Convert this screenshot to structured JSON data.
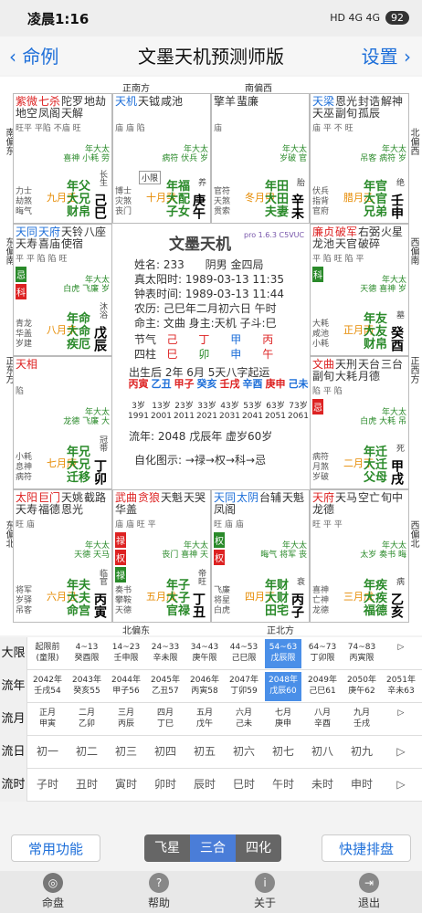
{
  "status": {
    "time": "凌晨1:16",
    "battery": "92",
    "signal": "HD 4G 4G"
  },
  "nav": {
    "back": "命例",
    "title": "文墨天机预测师版",
    "settings": "设置"
  },
  "dirs": {
    "top1": "正南方",
    "top2": "南偏西",
    "bottom1": "北偏东",
    "bottom2": "正北方",
    "left1": "南偏东",
    "left2": "东偏南",
    "left3": "正东方",
    "left4": "东偏北",
    "right1": "西偏南",
    "right2": "正西方",
    "right3": "西偏北",
    "right4": "北偏西"
  },
  "cells": [
    {
      "id": "si",
      "stars": [
        [
          "紫微",
          "#d22"
        ],
        [
          "七杀",
          "#d22"
        ],
        [
          "陀罗",
          "#333"
        ],
        [
          "地劫",
          "#333"
        ],
        [
          "地空",
          "#333"
        ],
        [
          "凤阁",
          "#333"
        ],
        [
          "天解",
          "#333"
        ]
      ],
      "bright": "旺平 平陷 不庙 旺",
      "minor": "年大太\n喜神 小耗 劳",
      "gods": "力士\n劫煞\n晦气",
      "age": "九月壬",
      "pal": "年父\n大兄\n财帛",
      "palcolor": "#2a8a2a",
      "chs": "长生",
      "gz": "己巳",
      "small": ""
    },
    {
      "id": "wu",
      "stars": [
        [
          "天机",
          "#1e6fd9"
        ],
        [
          "天钺",
          "#333"
        ],
        [
          "咸池",
          "#333"
        ]
      ],
      "bright": "庙 庙 陷",
      "minor": "年大太\n病符 伏兵 岁",
      "gods": "博士\n灾煞\n丧门",
      "age": "十月癸",
      "pal": "年福\n大配\n子女",
      "palcolor": "#2a8a2a",
      "chs": "养",
      "gz": "庚午",
      "small": "小限"
    },
    {
      "id": "wei",
      "stars": [
        [
          "擎羊",
          "#333"
        ],
        [
          "蜚廉",
          "#333"
        ]
      ],
      "bright": "庙",
      "minor": "年大太\n岁破 官",
      "gods": "官符\n天煞\n贯索",
      "age": "冬月甲",
      "pal": "年田\n大田\n夫妻",
      "palcolor": "#2a8a2a",
      "chs": "胎",
      "gz": "辛未",
      "small": ""
    },
    {
      "id": "shen",
      "stars": [
        [
          "天梁",
          "#1e6fd9"
        ],
        [
          "恩光",
          "#333"
        ],
        [
          "封诰",
          "#333"
        ],
        [
          "解神",
          "#333"
        ],
        [
          "天巫",
          "#333"
        ],
        [
          "副旬",
          "#333"
        ],
        [
          "孤辰",
          "#333"
        ]
      ],
      "bright": "庙 平 不 旺",
      "minor": "年大太\n吊客 病符 岁",
      "gods": "伏兵\n指背\n官府",
      "age": "腊月乙",
      "pal": "年官\n大官\n兄弟",
      "palcolor": "#2a8a2a",
      "chs": "绝",
      "gz": "壬申",
      "small": ""
    },
    {
      "id": "chen",
      "stars": [
        [
          "天同",
          "#1e6fd9"
        ],
        [
          "天府",
          "#1e6fd9"
        ],
        [
          "天铃",
          "#333"
        ],
        [
          "八座",
          "#333"
        ],
        [
          "天寿",
          "#333"
        ],
        [
          "喜庙",
          "#333"
        ],
        [
          "使宿",
          "#333"
        ]
      ],
      "bright": "平 平 陷 陷 旺",
      "minor": "年大太\n白虎 飞廉 岁",
      "gods": "青龙\n华盖\n岁建",
      "age": "八月辛",
      "pal": "年命\n大命\n疾厄",
      "palcolor": "#2a8a2a",
      "chs": "沐浴",
      "gz": "戊辰",
      "small": "",
      "hua": [
        [
          "忌",
          "#2a8a2a"
        ],
        [
          "科",
          "#d22"
        ]
      ]
    },
    {
      "id": "you",
      "stars": [
        [
          "廉贞",
          "#d22"
        ],
        [
          "破军",
          "#d22"
        ],
        [
          "右弼",
          "#333"
        ],
        [
          "火星",
          "#333"
        ],
        [
          "龙池",
          "#333"
        ],
        [
          "天官",
          "#333"
        ],
        [
          "破碎",
          "#333"
        ]
      ],
      "bright": "平 陷 旺 陷 平",
      "minor": "年大太\n天德 喜神 岁",
      "gods": "大耗\n咸池\n小耗",
      "age": "正月丙",
      "pal": "年友\n大友\n财帛",
      "palcolor": "#2a8a2a",
      "chs": "墓",
      "gz": "癸酉",
      "small": "",
      "hua": [
        [
          "科",
          "#2a8a2a"
        ]
      ]
    },
    {
      "id": "mao",
      "stars": [
        [
          "天相",
          "#d22"
        ]
      ],
      "bright": "陷",
      "minor": "年大太\n龙德 飞廉 大",
      "gods": "小耗\n息神\n病符",
      "age": "七月庚",
      "pal": "年兄\n大兄\n迁移",
      "palcolor": "#2a8a2a",
      "chs": "冠带",
      "gz": "丁卯",
      "small": ""
    },
    {
      "id": "xu",
      "stars": [
        [
          "文曲",
          "#d22"
        ],
        [
          "天刑",
          "#333"
        ],
        [
          "天台",
          "#333"
        ],
        [
          "三台",
          "#333"
        ],
        [
          "副旬",
          "#333"
        ],
        [
          "大耗",
          "#333"
        ],
        [
          "月德",
          "#333"
        ]
      ],
      "bright": "陷 平 陷",
      "minor": "年大太\n白虎 大耗 吊",
      "gods": "病符\n月煞\n岁破",
      "age": "二月丁",
      "pal": "年迁\n大迁\n父母",
      "palcolor": "#2a8a2a",
      "chs": "死",
      "gz": "甲戌",
      "small": "",
      "hua": [
        [
          "忌",
          "#d22"
        ]
      ]
    },
    {
      "id": "yin",
      "stars": [
        [
          "太阳",
          "#d22"
        ],
        [
          "巨门",
          "#d22"
        ],
        [
          "天姚",
          "#333"
        ],
        [
          "截路",
          "#333"
        ],
        [
          "天寿",
          "#333"
        ],
        [
          "福德",
          "#333"
        ],
        [
          "恩光",
          "#333"
        ]
      ],
      "bright": "旺 庙",
      "minor": "年大太\n天德 天马",
      "gods": "将军\n岁驿\n吊客",
      "age": "六月己",
      "pal": "年夫\n大夫\n命宫",
      "palcolor": "#2a8a2a",
      "chs": "临官",
      "gz": "丙寅",
      "small": ""
    },
    {
      "id": "chou",
      "stars": [
        [
          "武曲",
          "#d22"
        ],
        [
          "贪狼",
          "#d22"
        ],
        [
          "天魁",
          "#333"
        ],
        [
          "天哭",
          "#333"
        ],
        [
          "华盖",
          "#333"
        ]
      ],
      "bright": "庙 庙 旺 平",
      "minor": "年大太\n丧门 喜神 天",
      "gods": "奏书\n攀鞍\n天德",
      "age": "五月戊",
      "pal": "年子\n大子\n官禄",
      "palcolor": "#2a8a2a",
      "chs": "帝旺",
      "gz": "丁丑",
      "small": "",
      "hua": [
        [
          "禄",
          "#d22"
        ],
        [
          "权",
          "#d22"
        ],
        [
          "禄",
          "#2a8a2a"
        ]
      ]
    },
    {
      "id": "zi",
      "stars": [
        [
          "天同",
          "#1e6fd9"
        ],
        [
          "太阴",
          "#1e6fd9"
        ],
        [
          "台辅",
          "#333"
        ],
        [
          "天魁",
          "#333"
        ],
        [
          "凤阁",
          "#333"
        ]
      ],
      "bright": "旺 庙 庙",
      "minor": "年大太\n晦气 将军 丧",
      "gods": "飞廉\n将星\n白虎",
      "age": "四月丁",
      "pal": "年财\n大财\n田宅",
      "palcolor": "#2a8a2a",
      "chs": "衰",
      "gz": "丙子",
      "small": "",
      "hua": [
        [
          "权",
          "#2a8a2a"
        ],
        [
          "权",
          "#d22"
        ]
      ]
    },
    {
      "id": "hai",
      "stars": [
        [
          "天府",
          "#d22"
        ],
        [
          "天马",
          "#333"
        ],
        [
          "空亡",
          "#333"
        ],
        [
          "旬中",
          "#333"
        ],
        [
          "龙德",
          "#333"
        ]
      ],
      "bright": "旺 平 平",
      "minor": "年大太\n太岁 奏书 晦",
      "gods": "喜神\n亡神\n龙德",
      "age": "三月戊",
      "pal": "年疾\n大疾\n福德",
      "palcolor": "#2a8a2a",
      "chs": "病",
      "gz": "乙亥",
      "small": ""
    }
  ],
  "center": {
    "title": "文墨天机",
    "ver": "pro 1.6.3 C5VUC",
    "name": "姓名: 233",
    "gender": "阴男 金四局",
    "sun_time": "真太阳时: 1989-03-13 11:35",
    "clock_time": "钟表时间: 1989-03-13 11:44",
    "lunar": "农历: 己巳年二月初六日 午时",
    "ming": "命主: 文曲 身主:天机 子斗:巳",
    "jieqi_label": "节气",
    "sizhu_label": "四柱",
    "pillars": [
      "己",
      "丁",
      "甲",
      "丙",
      "巳",
      "卯",
      "申",
      "午"
    ],
    "qiyun": "出生后 2年 6月 5天八字起运",
    "dayun_gz": [
      "丙寅",
      "乙丑",
      "甲子",
      "癸亥",
      "壬戌",
      "辛酉",
      "庚申",
      "己未"
    ],
    "dayun_age": [
      "3岁",
      "13岁",
      "23岁",
      "33岁",
      "43岁",
      "53岁",
      "63岁",
      "73岁"
    ],
    "dayun_year": [
      "1991",
      "2001",
      "2011",
      "2021",
      "2031",
      "2041",
      "2051",
      "2061"
    ],
    "liunian": "流年: 2048 戊辰年 虚岁60岁",
    "zihua": "自化图示: →禄→权→科→忌"
  },
  "timeline": {
    "rows": [
      "大限",
      "流年",
      "流月",
      "流日",
      "流时"
    ],
    "daxian": [
      "起限前\n(童限)",
      "4~13\n癸酉限",
      "14~23\n壬申限",
      "24~33\n辛未限",
      "34~43\n庚午限",
      "44~53\n己巳限",
      "54~63\n戊辰限",
      "64~73\n丁卯限",
      "74~83\n丙寅限",
      "▷"
    ],
    "liunian": [
      "2042年\n壬戌54",
      "2043年\n癸亥55",
      "2044年\n甲子56",
      "2045年\n乙丑57",
      "2046年\n丙寅58",
      "2047年\n丁卯59",
      "2048年\n戊辰60",
      "2049年\n己巳61",
      "2050年\n庚午62",
      "2051年\n辛未63"
    ],
    "liuyue": [
      "正月\n甲寅",
      "二月\n乙卯",
      "三月\n丙辰",
      "四月\n丁巳",
      "五月\n戊午",
      "六月\n己未",
      "七月\n庚申",
      "八月\n辛酉",
      "九月\n壬戌",
      "▷"
    ],
    "liuri": [
      "初一",
      "初二",
      "初三",
      "初四",
      "初五",
      "初六",
      "初七",
      "初八",
      "初九",
      "▷"
    ],
    "liushi": [
      "子时",
      "丑时",
      "寅时",
      "卯时",
      "辰时",
      "巳时",
      "午时",
      "未时",
      "申时",
      "▷"
    ]
  },
  "tools": {
    "common": "常用功能",
    "seg": [
      "飞星",
      "三合",
      "四化"
    ],
    "quick": "快捷排盘"
  },
  "tabs": [
    "命盘",
    "帮助",
    "关于",
    "退出"
  ]
}
